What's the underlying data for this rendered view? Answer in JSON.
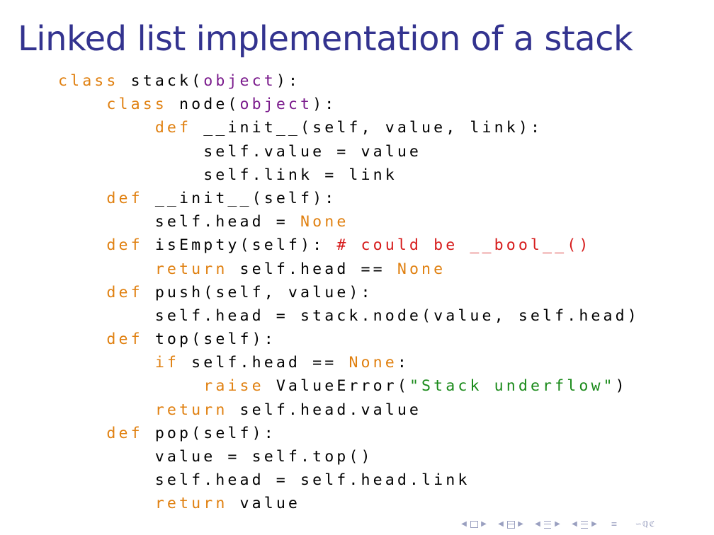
{
  "slide": {
    "title": "Linked list implementation of a stack"
  },
  "code": {
    "lines": [
      [
        {
          "t": "class",
          "k": "kw"
        },
        {
          "t": " stack(",
          "k": "plain"
        },
        {
          "t": "object",
          "k": "builtin"
        },
        {
          "t": "):",
          "k": "plain"
        }
      ],
      [
        {
          "t": "    ",
          "k": "plain"
        },
        {
          "t": "class",
          "k": "kw"
        },
        {
          "t": " node(",
          "k": "plain"
        },
        {
          "t": "object",
          "k": "builtin"
        },
        {
          "t": "):",
          "k": "plain"
        }
      ],
      [
        {
          "t": "        ",
          "k": "plain"
        },
        {
          "t": "def",
          "k": "kw"
        },
        {
          "t": " __init__(self, value, link):",
          "k": "plain"
        }
      ],
      [
        {
          "t": "            self.value = value",
          "k": "plain"
        }
      ],
      [
        {
          "t": "            self.link = link",
          "k": "plain"
        }
      ],
      [
        {
          "t": "    ",
          "k": "plain"
        },
        {
          "t": "def",
          "k": "kw"
        },
        {
          "t": " __init__(self):",
          "k": "plain"
        }
      ],
      [
        {
          "t": "        self.head = ",
          "k": "plain"
        },
        {
          "t": "None",
          "k": "kw"
        }
      ],
      [
        {
          "t": "    ",
          "k": "plain"
        },
        {
          "t": "def",
          "k": "kw"
        },
        {
          "t": " isEmpty(self): ",
          "k": "plain"
        },
        {
          "t": "# could be __bool__()",
          "k": "comment"
        }
      ],
      [
        {
          "t": "        ",
          "k": "plain"
        },
        {
          "t": "return",
          "k": "kw"
        },
        {
          "t": " self.head == ",
          "k": "plain"
        },
        {
          "t": "None",
          "k": "kw"
        }
      ],
      [
        {
          "t": "    ",
          "k": "plain"
        },
        {
          "t": "def",
          "k": "kw"
        },
        {
          "t": " push(self, value):",
          "k": "plain"
        }
      ],
      [
        {
          "t": "        self.head = stack.node(value, self.head)",
          "k": "plain"
        }
      ],
      [
        {
          "t": "    ",
          "k": "plain"
        },
        {
          "t": "def",
          "k": "kw"
        },
        {
          "t": " top(self):",
          "k": "plain"
        }
      ],
      [
        {
          "t": "        ",
          "k": "plain"
        },
        {
          "t": "if",
          "k": "kw"
        },
        {
          "t": " self.head == ",
          "k": "plain"
        },
        {
          "t": "None",
          "k": "kw"
        },
        {
          "t": ":",
          "k": "plain"
        }
      ],
      [
        {
          "t": "            ",
          "k": "plain"
        },
        {
          "t": "raise",
          "k": "kw"
        },
        {
          "t": " ValueError(",
          "k": "plain"
        },
        {
          "t": "\"Stack underflow\"",
          "k": "string"
        },
        {
          "t": ")",
          "k": "plain"
        }
      ],
      [
        {
          "t": "        ",
          "k": "plain"
        },
        {
          "t": "return",
          "k": "kw"
        },
        {
          "t": " self.head.value",
          "k": "plain"
        }
      ],
      [
        {
          "t": "    ",
          "k": "plain"
        },
        {
          "t": "def",
          "k": "kw"
        },
        {
          "t": " pop(self):",
          "k": "plain"
        }
      ],
      [
        {
          "t": "        value = self.top()",
          "k": "plain"
        }
      ],
      [
        {
          "t": "        self.head = self.head.link",
          "k": "plain"
        }
      ],
      [
        {
          "t": "        ",
          "k": "plain"
        },
        {
          "t": "return",
          "k": "kw"
        },
        {
          "t": " value",
          "k": "plain"
        }
      ]
    ]
  },
  "nav": {
    "arrow_left": "◀",
    "arrow_right": "▶",
    "eq_symbol": "≡",
    "search_symbol": "∽ℚℭ",
    "icons": [
      "frame-icon",
      "subsection-icon",
      "section-icon",
      "document-icon",
      "appendix-icon",
      "search-icon"
    ]
  },
  "colors": {
    "title": "#33338f",
    "keyword": "#e08010",
    "builtin": "#7a1a8c",
    "comment": "#d61a1a",
    "string": "#1a8a1a",
    "nav": "#9aa0c0"
  }
}
